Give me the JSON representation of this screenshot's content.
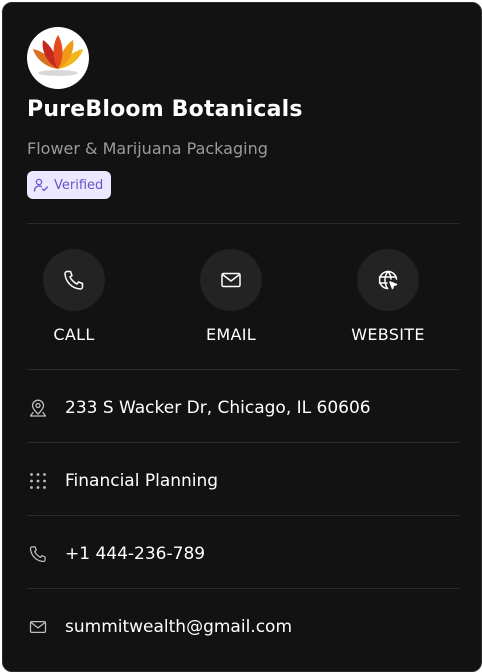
{
  "company": {
    "name": "PureBloom Botanicals",
    "subtitle": "Flower & Marijuana Packaging",
    "verified_label": "Verified",
    "logo_icon": "lotus-logo"
  },
  "actions": [
    {
      "label": "CALL",
      "icon": "phone-icon"
    },
    {
      "label": "EMAIL",
      "icon": "mail-icon"
    },
    {
      "label": "WEBSITE",
      "icon": "globe-icon"
    }
  ],
  "details": [
    {
      "icon": "location-icon",
      "text": "233 S Wacker Dr, Chicago, IL 60606"
    },
    {
      "icon": "grid-icon",
      "text": "Financial Planning"
    },
    {
      "icon": "phone-icon",
      "text": "+1 444-236-789"
    },
    {
      "icon": "mail-icon",
      "text": "summitwealth@gmail.com"
    }
  ],
  "colors": {
    "card_background": "#121212",
    "action_circle": "#232323",
    "badge_background": "#ece8ff",
    "badge_text": "#6a52c9",
    "subtitle_text": "#9a9a9a"
  }
}
